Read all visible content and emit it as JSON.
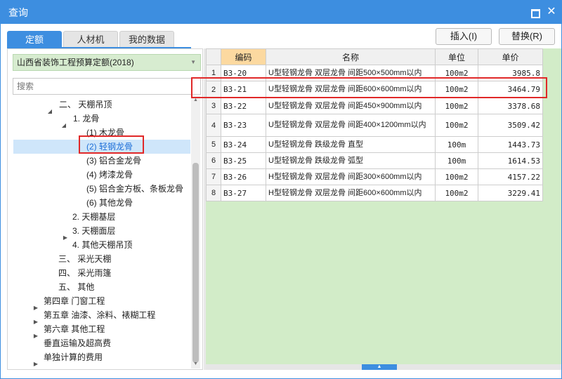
{
  "window": {
    "title": "查询",
    "maximize_icon": "maximize-icon",
    "close_icon": "close-icon",
    "close_glyph": "✕",
    "accent_color": "#3d8ee0"
  },
  "tabs": [
    {
      "label": "定额",
      "active": true
    },
    {
      "label": "人材机",
      "active": false
    },
    {
      "label": "我的数据",
      "active": false
    }
  ],
  "actions": {
    "insert_label": "插入(I)",
    "replace_label": "替换(R)"
  },
  "quota_library": {
    "selected": "山西省装饰工程预算定额(2018)"
  },
  "search": {
    "placeholder": "搜索"
  },
  "tree": [
    {
      "label": "二、 天棚吊顶",
      "arrow": "◢"
    },
    {
      "label": "1. 龙骨",
      "arrow": "◢"
    },
    {
      "label": "(1) 木龙骨",
      "arrow": ""
    },
    {
      "label": "(2) 轻钢龙骨",
      "arrow": "",
      "selected": true
    },
    {
      "label": "(3) 铝合金龙骨",
      "arrow": ""
    },
    {
      "label": "(4) 烤漆龙骨",
      "arrow": ""
    },
    {
      "label": "(5) 铝合金方板、条板龙骨",
      "arrow": ""
    },
    {
      "label": "(6) 其他龙骨",
      "arrow": ""
    },
    {
      "label": "2. 天棚基层",
      "arrow": ""
    },
    {
      "label": "3. 天棚面层",
      "arrow": "▶"
    },
    {
      "label": "4. 其他天棚吊顶",
      "arrow": ""
    },
    {
      "label": "三、 采光天棚",
      "arrow": ""
    },
    {
      "label": "四、 采光雨篷",
      "arrow": ""
    },
    {
      "label": "五、 其他",
      "arrow": ""
    },
    {
      "label": "第四章 门窗工程",
      "arrow": "▶"
    },
    {
      "label": "第五章 油漆、涂料、裱糊工程",
      "arrow": "▶"
    },
    {
      "label": "第六章 其他工程",
      "arrow": "▶"
    },
    {
      "label": "垂直运输及超高费",
      "arrow": ""
    },
    {
      "label": "单独计算的费用",
      "arrow": "▶"
    }
  ],
  "grid": {
    "columns": [
      "编码",
      "名称",
      "单位",
      "单价"
    ],
    "rows": [
      {
        "no": "1",
        "code": "B3-20",
        "name": "U型轻钢龙骨 双层龙骨 间距500×500mm以内",
        "unit": "100m2",
        "price": "3985.8"
      },
      {
        "no": "2",
        "code": "B3-21",
        "name": "U型轻钢龙骨 双层龙骨 间距600×600mm以内",
        "unit": "100m2",
        "price": "3464.79"
      },
      {
        "no": "3",
        "code": "B3-22",
        "name": "U型轻钢龙骨 双层龙骨 间距450×900mm以内",
        "unit": "100m2",
        "price": "3378.68"
      },
      {
        "no": "4",
        "code": "B3-23",
        "name": "U型轻钢龙骨 双层龙骨 间距400×1200mm以内",
        "unit": "100m2",
        "price": "3509.42"
      },
      {
        "no": "5",
        "code": "B3-24",
        "name": "U型轻钢龙骨 跌级龙骨 直型",
        "unit": "100m",
        "price": "1443.73"
      },
      {
        "no": "6",
        "code": "B3-25",
        "name": "U型轻钢龙骨 跌级龙骨 弧型",
        "unit": "100m",
        "price": "1614.53"
      },
      {
        "no": "7",
        "code": "B3-26",
        "name": "H型轻钢龙骨 双层龙骨 间距300×600mm以内",
        "unit": "100m2",
        "price": "4157.22"
      },
      {
        "no": "8",
        "code": "B3-27",
        "name": "H型轻钢龙骨 双层龙骨 间距600×600mm以内",
        "unit": "100m2",
        "price": "3229.41"
      }
    ]
  }
}
